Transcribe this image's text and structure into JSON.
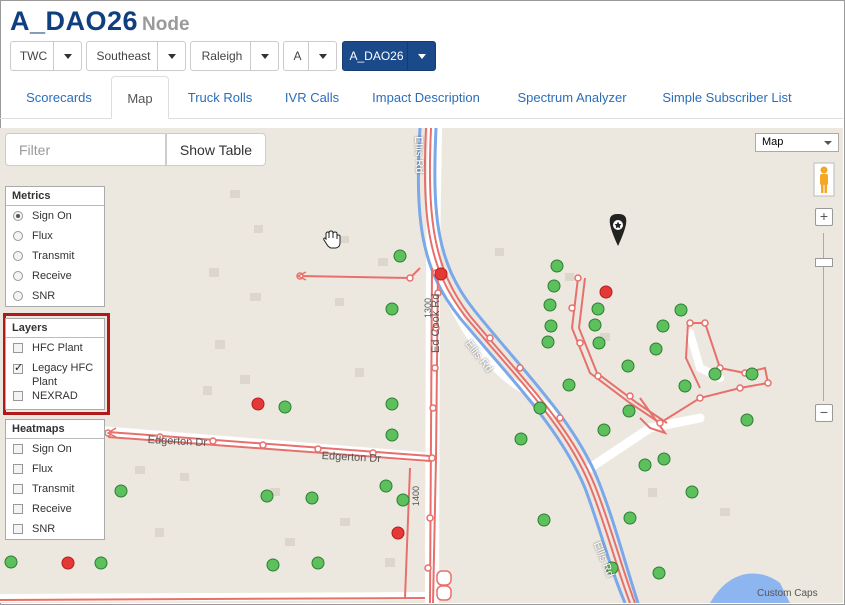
{
  "header": {
    "title": "A_DAO26",
    "subtitle": "Node"
  },
  "selectors": [
    {
      "label": "TWC"
    },
    {
      "label": "Southeast"
    },
    {
      "label": "Raleigh"
    },
    {
      "label": "A"
    },
    {
      "label": "A_DAO26"
    }
  ],
  "tabs": [
    "Scorecards",
    "Map",
    "Truck Rolls",
    "IVR Calls",
    "Impact Description",
    "Spectrum Analyzer",
    "Simple Subscriber List"
  ],
  "active_tab": "Map",
  "toolbar": {
    "filter_placeholder": "Filter",
    "show_table_label": "Show Table"
  },
  "map_type": {
    "selected": "Map"
  },
  "metrics": {
    "title": "Metrics",
    "options": [
      "Sign On",
      "Flux",
      "Transmit",
      "Receive",
      "SNR"
    ],
    "selected": "Sign On"
  },
  "layers": {
    "title": "Layers",
    "items": [
      {
        "label": "HFC Plant",
        "checked": false
      },
      {
        "label": "Legacy HFC Plant",
        "checked": true
      },
      {
        "label": "NEXRAD",
        "checked": false
      }
    ]
  },
  "heatmaps": {
    "title": "Heatmaps",
    "items": [
      "Sign On",
      "Flux",
      "Transmit",
      "Receive",
      "SNR"
    ]
  },
  "map_labels": {
    "ellis_top": "Ellis Rd",
    "ellis_mid": "Ellis Rd",
    "ellis_bottom": "Ellis Rd",
    "edgerton1": "Edgerton Dr",
    "edgerton2": "Edgerton Dr",
    "edcook": "Ed Cook Rd",
    "num1300": "1300",
    "num1400": "1400"
  },
  "copyright": "Custom Caps",
  "colors": {
    "accent": "#1a4a8a",
    "plant_line": "#e8706c",
    "road_blue": "#6fa3e6",
    "node_green": "#4caf50",
    "node_red": "#e53935"
  }
}
